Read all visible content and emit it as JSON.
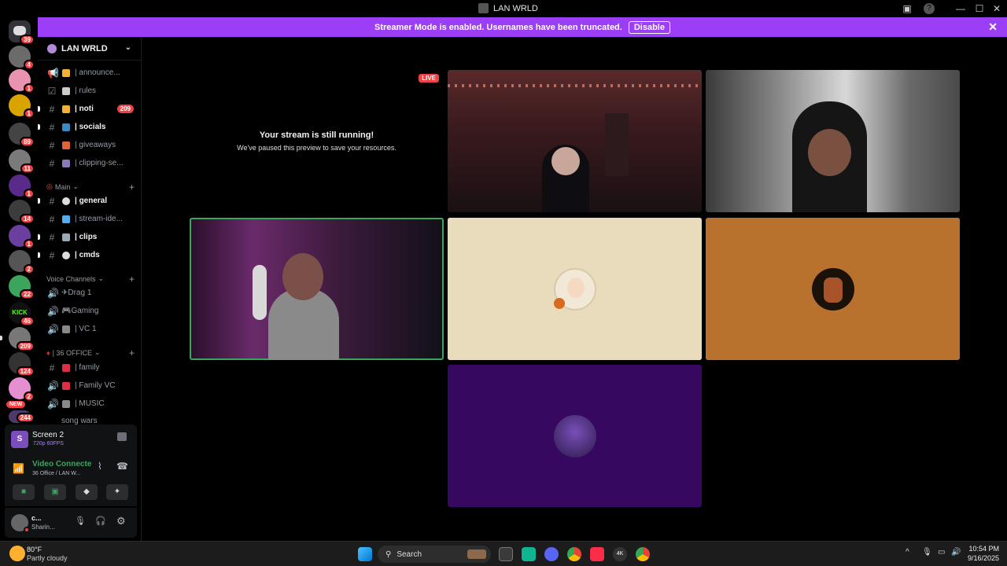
{
  "window": {
    "title": "LAN WRLD"
  },
  "banner": {
    "text": "Streamer Mode is enabled. Usernames have been truncated.",
    "button": "Disable"
  },
  "rail": {
    "badges": [
      "39",
      "4",
      "1",
      "1",
      "89",
      "11",
      "1",
      "14",
      "1",
      "2",
      "22",
      "46",
      "209",
      "124",
      "2",
      "244"
    ],
    "new_label": "NEW"
  },
  "server": {
    "name": "LAN WRLD"
  },
  "channels": [
    {
      "icon": "megaphone",
      "name": "| announce...",
      "bold": false
    },
    {
      "icon": "check",
      "name": "| rules",
      "bold": false
    },
    {
      "icon": "hash",
      "name": "| noti",
      "bold": true,
      "count": "209"
    },
    {
      "icon": "hash",
      "name": "| socials",
      "bold": true
    },
    {
      "icon": "hash",
      "name": "| giveaways",
      "bold": false
    },
    {
      "icon": "hash",
      "name": "| clipping-se...",
      "bold": false
    }
  ],
  "category_main": "Main",
  "main_channels": [
    {
      "name": "| general",
      "bold": true
    },
    {
      "name": "| stream-ide...",
      "bold": false
    },
    {
      "name": "| clips",
      "bold": true
    },
    {
      "name": "| cmds",
      "bold": true
    }
  ],
  "category_voice": "Voice Channels",
  "voice_channels": [
    {
      "name": "✈Drag 1"
    },
    {
      "name": "🎮Gaming"
    },
    {
      "name": "| VC 1"
    }
  ],
  "category_office": "| 36 OFFICE",
  "office_channels": [
    {
      "name": "| family",
      "type": "text"
    },
    {
      "name": "| Family VC",
      "type": "voice"
    },
    {
      "name": "| MUSIC",
      "type": "voice"
    },
    {
      "name": "song wars",
      "type": "text"
    }
  ],
  "screen_panel": {
    "title": "Screen 2",
    "quality": "720p 60FPS"
  },
  "voice_panel": {
    "status": "Video Connecte",
    "location": "36 Office / LAN W..."
  },
  "user_panel": {
    "name": "c...",
    "status": "Sharin..."
  },
  "stream": {
    "live": "LIVE",
    "heading": "Your stream is still running!",
    "sub": "We've paused this preview to save your resources."
  },
  "colors": {
    "accent": "#9b3ef5",
    "speaking": "#3ba55d",
    "tile_cream": "#e8dcbc",
    "tile_orange": "#b9722e",
    "tile_purple": "#37085f"
  },
  "taskbar": {
    "weather_temp": "80°F",
    "weather_desc": "Partly cloudy",
    "search": "Search",
    "time": "10:54 PM",
    "date": "9/16/2025"
  }
}
